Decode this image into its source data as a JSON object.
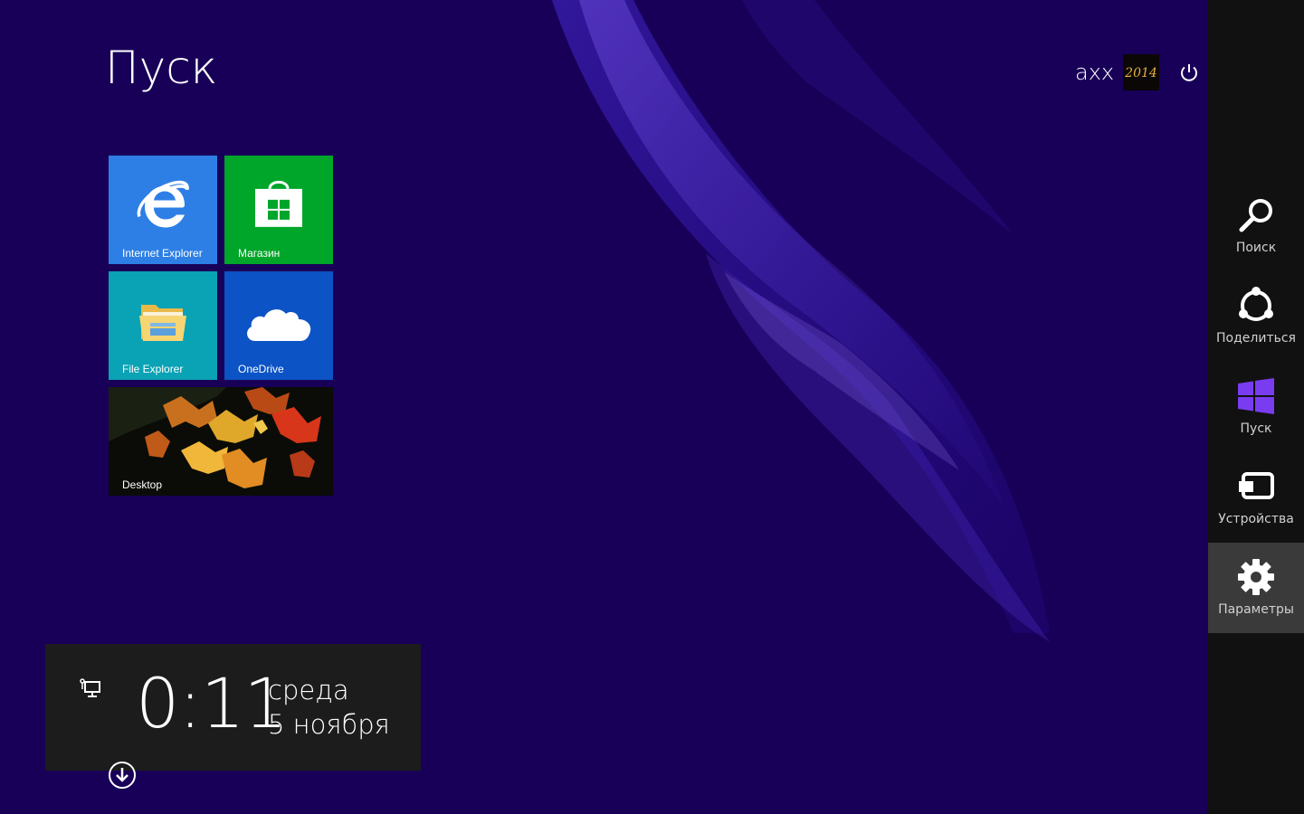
{
  "start": {
    "title": "Пуск"
  },
  "user": {
    "name": "axx",
    "avatar_text": "2014"
  },
  "tiles": [
    {
      "label": "Internet Explorer",
      "icon": "internet-explorer-icon",
      "color": "#2d7fe5"
    },
    {
      "label": "Магазин",
      "icon": "store-icon",
      "color": "#00a62a"
    },
    {
      "label": "File Explorer",
      "icon": "file-explorer-icon",
      "color": "#0aa2b5"
    },
    {
      "label": "OneDrive",
      "icon": "onedrive-icon",
      "color": "#0c53c5"
    },
    {
      "label": "Desktop",
      "icon": "desktop-wallpaper",
      "color": "#0b0c07"
    }
  ],
  "clock": {
    "time": "0:11",
    "day": "среда",
    "date": "5 ноября"
  },
  "charms": [
    {
      "label": "Поиск",
      "icon": "search-icon"
    },
    {
      "label": "Поделиться",
      "icon": "share-icon"
    },
    {
      "label": "Пуск",
      "icon": "windows-logo-icon"
    },
    {
      "label": "Устройства",
      "icon": "devices-icon"
    },
    {
      "label": "Параметры",
      "icon": "settings-gear-icon",
      "active": true
    }
  ],
  "colors": {
    "background": "#180058",
    "charms_bar": "#111111",
    "charm_active": "#3a3a3a",
    "windows_logo": "#7a3cf0"
  }
}
